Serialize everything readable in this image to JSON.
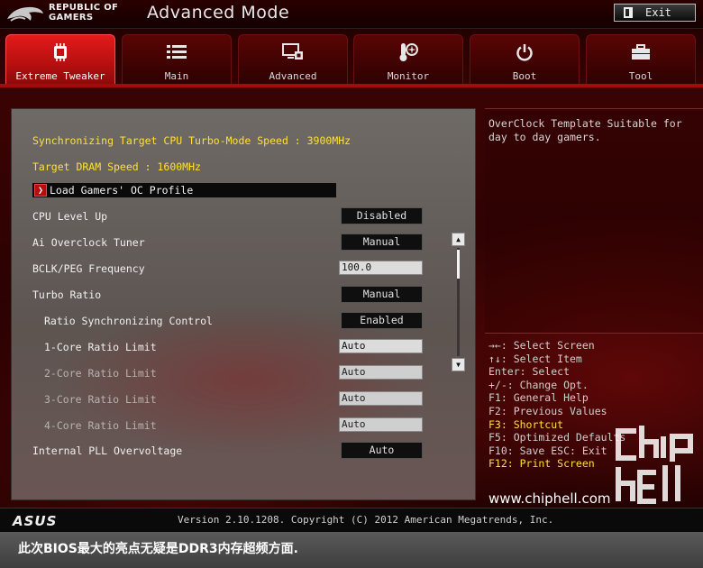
{
  "header": {
    "brand_line1": "REPUBLIC OF",
    "brand_line2": "GAMERS",
    "mode_title": "Advanced Mode",
    "exit_label": "Exit"
  },
  "tabs": [
    {
      "label": "Extreme Tweaker",
      "icon": "ram-chip-icon",
      "active": true
    },
    {
      "label": "Main",
      "icon": "list-icon",
      "active": false
    },
    {
      "label": "Advanced",
      "icon": "monitor-chip-icon",
      "active": false
    },
    {
      "label": "Monitor",
      "icon": "thermometer-fan-icon",
      "active": false
    },
    {
      "label": "Boot",
      "icon": "power-icon",
      "active": false
    },
    {
      "label": "Tool",
      "icon": "toolbox-icon",
      "active": false
    }
  ],
  "main": {
    "sync_speed": "Synchronizing Target CPU Turbo-Mode Speed : 3900MHz",
    "dram_speed": "Target DRAM Speed : 1600MHz",
    "profile_label": "Load Gamers' OC Profile",
    "settings": [
      {
        "label": "CPU Level Up",
        "value": "Disabled",
        "kind": "select"
      },
      {
        "label": "Ai Overclock Tuner",
        "value": "Manual",
        "kind": "select"
      },
      {
        "label": "BCLK/PEG Frequency",
        "value": "100.0",
        "kind": "input"
      },
      {
        "label": "Turbo Ratio",
        "value": "Manual",
        "kind": "select"
      },
      {
        "label": "Ratio Synchronizing Control",
        "value": "Enabled",
        "kind": "select"
      },
      {
        "label": "1-Core Ratio Limit",
        "value": "Auto",
        "kind": "input"
      },
      {
        "label": "2-Core Ratio Limit",
        "value": "Auto",
        "kind": "input"
      },
      {
        "label": "3-Core Ratio Limit",
        "value": "Auto",
        "kind": "input"
      },
      {
        "label": "4-Core Ratio Limit",
        "value": "Auto",
        "kind": "input"
      },
      {
        "label": "Internal PLL Overvoltage",
        "value": "Auto",
        "kind": "select"
      }
    ]
  },
  "help": {
    "description": "OverClock Template Suitable for day to day gamers.",
    "keys": [
      "→←: Select Screen",
      "↑↓: Select Item",
      "Enter: Select",
      "+/-: Change Opt.",
      "F1: General Help",
      "F2: Previous Values",
      "F3: Shortcut",
      "F5: Optimized Defaults",
      "F10: Save  ESC: Exit",
      "F12: Print Screen"
    ]
  },
  "footer": {
    "brand": "ASUS",
    "version": "Version 2.10.1208. Copyright (C) 2012 American Megatrends, Inc."
  },
  "watermark": {
    "url": "www.chiphell.com",
    "logo_text": "chip hell"
  },
  "caption": "此次BIOS最大的亮点无疑是DDR3内存超频方面.",
  "colors": {
    "accent_red": "#d41414",
    "highlight_yellow": "#ffe033",
    "panel_gray": "#6e6a66"
  }
}
